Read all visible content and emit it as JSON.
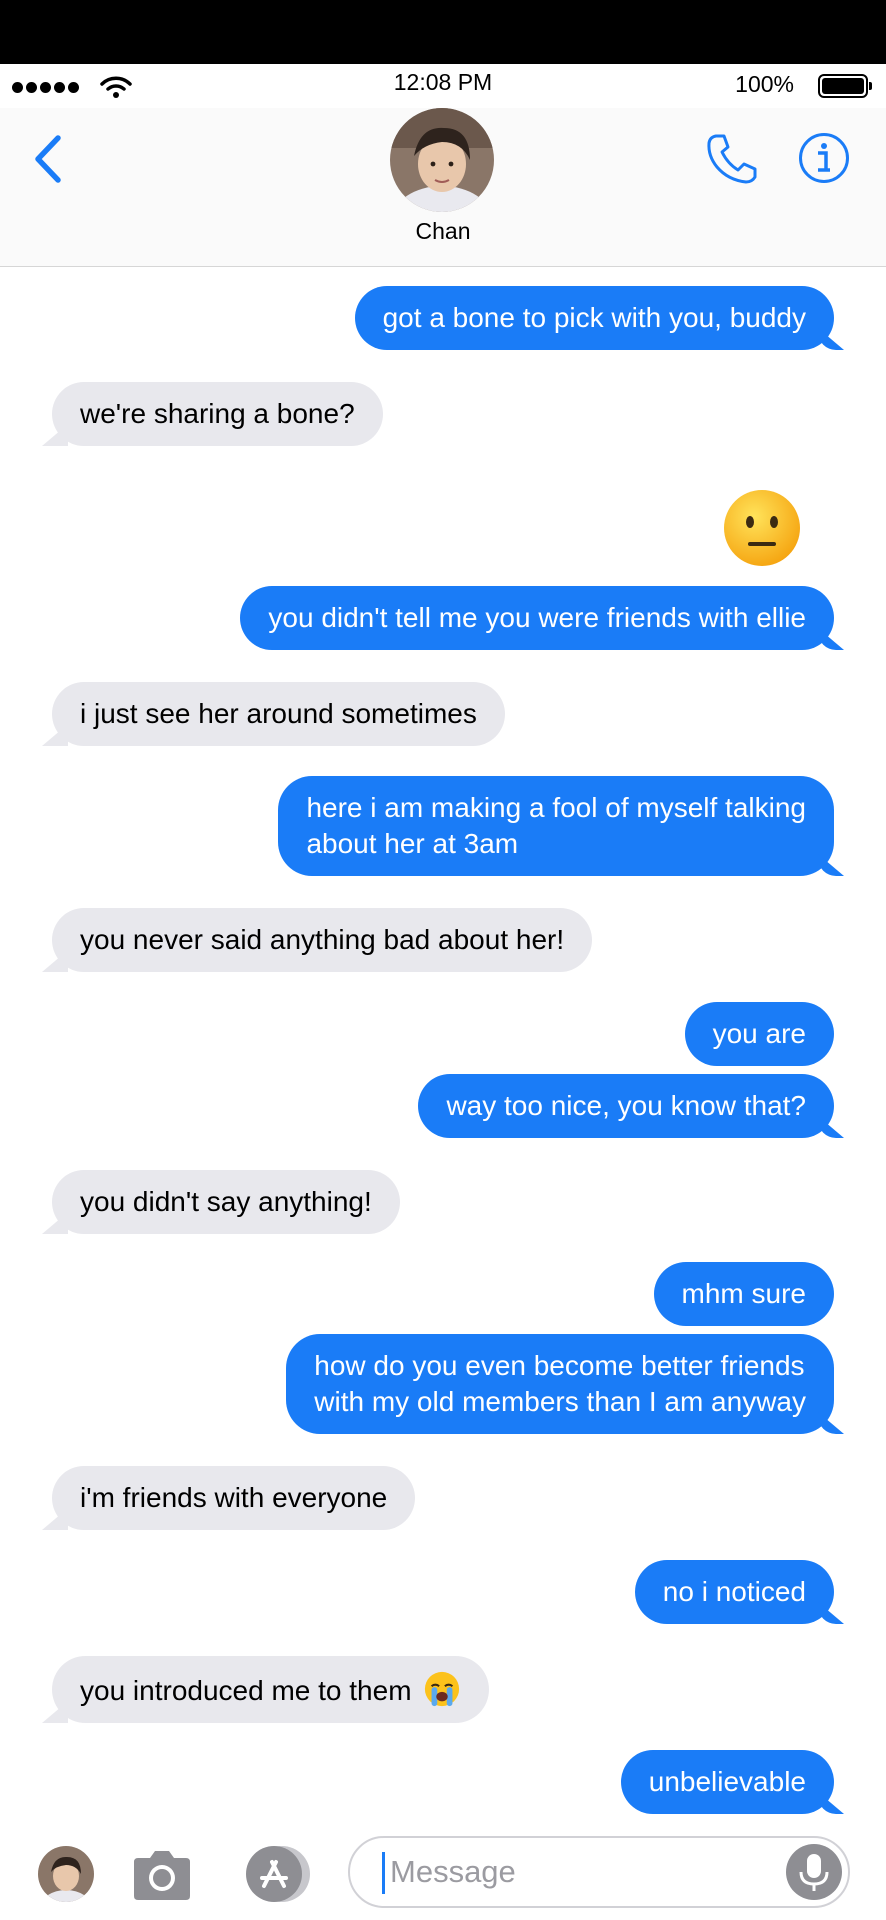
{
  "status_bar": {
    "time": "12:08 PM",
    "battery": "100%"
  },
  "header": {
    "contact_name": "Chan"
  },
  "messages": [
    {
      "side": "sent",
      "text": "got a bone to pick with you, buddy"
    },
    {
      "side": "recv",
      "text": "we're sharing a bone?"
    },
    {
      "side": "sent",
      "emoji": "neutral-face"
    },
    {
      "side": "sent",
      "text": "you didn't tell me you were friends with ellie"
    },
    {
      "side": "recv",
      "text": "i just see her around sometimes"
    },
    {
      "side": "sent",
      "lines": [
        "here i am making a fool of myself talking",
        "about her at 3am"
      ]
    },
    {
      "side": "recv",
      "text": "you never said anything bad about her!"
    },
    {
      "side": "sent",
      "text": "you are"
    },
    {
      "side": "sent",
      "text": "way too nice, you know that?"
    },
    {
      "side": "recv",
      "text": "you didn't say anything!"
    },
    {
      "side": "sent",
      "text": "mhm sure"
    },
    {
      "side": "sent",
      "lines": [
        "how do you even become better friends",
        "with my old members than I am anyway"
      ]
    },
    {
      "side": "recv",
      "text": "i'm friends with everyone"
    },
    {
      "side": "sent",
      "text": "no i noticed"
    },
    {
      "side": "recv",
      "text": "you introduced me to them",
      "emoji": "loudly-crying-face"
    },
    {
      "side": "sent",
      "text": "unbelievable"
    }
  ],
  "composer": {
    "placeholder": "Message"
  },
  "colors": {
    "sent_bubble": "#1a7cf7",
    "received_bubble": "#e8e8ed",
    "accent": "#1a7cf7"
  }
}
